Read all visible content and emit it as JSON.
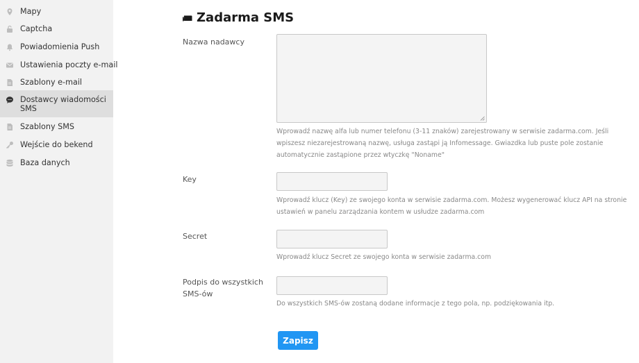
{
  "sidebar": {
    "items": [
      {
        "label": "Mapy",
        "icon": "map-pin-icon"
      },
      {
        "label": "Captcha",
        "icon": "lock-icon"
      },
      {
        "label": "Powiadomienia Push",
        "icon": "bell-icon"
      },
      {
        "label": "Ustawienia poczty e-mail",
        "icon": "envelope-icon"
      },
      {
        "label": "Szablony e-mail",
        "icon": "document-icon"
      },
      {
        "label": "Dostawcy wiadomości",
        "label2": "SMS",
        "icon": "sms-bubble-icon",
        "active": true
      },
      {
        "label": "Szablony SMS",
        "icon": "document-icon"
      },
      {
        "label": "Wejście do bekend",
        "icon": "key-icon"
      },
      {
        "label": "Baza danych",
        "icon": "database-icon"
      }
    ]
  },
  "main": {
    "title": "Zadarma SMS",
    "fields": {
      "sender": {
        "label": "Nazwa nadawcy",
        "value": "",
        "help": [
          "Wprowadź nazwę alfa lub numer telefonu (3-11 znaków) zarejestrowany w serwisie zadarma.com. Jeśli",
          "wpiszesz niezarejestrowaną nazwę, usługa zastąpi ją Infomessage. Gwiazdka lub puste pole zostanie",
          "automatycznie zastąpione przez wtyczkę \"Noname\""
        ]
      },
      "key": {
        "label": "Key",
        "value": "",
        "help": [
          "Wprowadź klucz (Key) ze swojego konta w serwisie zadarma.com. Możesz wygenerować klucz API na stronie",
          "ustawień w panelu zarządzania kontem w usłudze zadarma.com"
        ]
      },
      "secret": {
        "label": "Secret",
        "value": "",
        "help": [
          "Wprowadź klucz Secret ze swojego konta w serwisie zadarma.com"
        ]
      },
      "signature": {
        "label": [
          "Podpis do wszystkich",
          "SMS-ów"
        ],
        "value": "",
        "help": [
          "Do wszystkich SMS-ów zostaną dodane informacje z tego pola, np. podziękowania itp."
        ]
      }
    },
    "save_label": "Zapisz"
  },
  "colors": {
    "sidebar_bg": "#f2f2f2",
    "active_item_bg": "#dedede",
    "accent": "#2196f3",
    "icon": "#bdbdbd"
  }
}
